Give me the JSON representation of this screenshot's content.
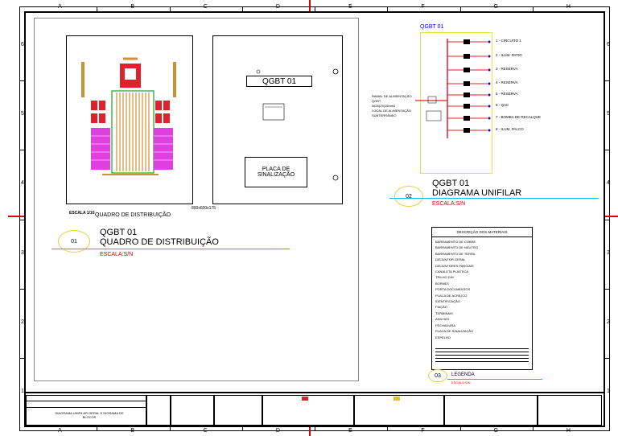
{
  "columns": [
    "A",
    "B",
    "C",
    "D",
    "E",
    "F",
    "G",
    "H"
  ],
  "rows": [
    "6",
    "5",
    "4",
    "3",
    "2",
    "1"
  ],
  "view1": {
    "number": "01",
    "title_line1": "QGBT 01",
    "title_line2": "QUADRO DE DISTRIBUIÇÃO",
    "scale": "ESCALA:S/N",
    "caption": "QUADRO DE DISTRIBUIÇÃO",
    "caption_scale": "ESCALA 1/10",
    "dim_label": "800x600x175"
  },
  "door": {
    "tag": "QGBT 01",
    "plate": "PLACA DE SINALIZAÇÃO"
  },
  "view2": {
    "number": "02",
    "title_line1": "QGBT 01",
    "title_line2": "DIAGRAMA UNIFILAR",
    "scale": "ESCALA:S/N",
    "header": "QGBT 01",
    "feeder_note": [
      "RAMAL DE ALIMENTAÇÃO",
      "QGBT",
      "3#25(25)16mm2",
      "LOCAL DE ALIMENTAÇÃO",
      "SUBTERRÂNEO"
    ],
    "circuits": [
      "1 - CIRCUITO 1",
      "2 - ILUM. PATIO",
      "3 - RESERVA",
      "4 - RESERVA",
      "5 - RESERVA",
      "6 - QAC",
      "7 - BOMBA DE RECALQUE",
      "8 - ILUM. PALCO"
    ]
  },
  "materials": {
    "title": "DESCRIÇÃO DOS MATERIAIS",
    "items": [
      "BARRAMENTO DE COBRE",
      "BARRAMENTO DE NEUTRO",
      "BARRAMENTO DE TERRA",
      "DISJUNTOR GERAL",
      "DISJUNTORES PARCIAIS",
      "CANALETA PLÁSTICA",
      "TRILHO DIN",
      "BORNES",
      "PORTA DOCUMENTOS",
      "PLACA DE ACRÍLICO",
      "IDENTIFICAÇÃO",
      "FIAÇÃO",
      "TERMINAIS",
      "ANILHAS",
      "FECHADURA",
      "PLACA DE SINALIZAÇÃO",
      "ESPELHO"
    ]
  },
  "legend": {
    "number": "03",
    "title": "LEGENDA",
    "scale": "ESCALA:S/N"
  },
  "titleblock": {
    "drawing_title": "DIAGRAMA UNIFILAR GERAL E DIGRAMA DE BLOCOS"
  },
  "colors": {
    "panel_red": "#e0202a",
    "panel_magenta": "#e040e0",
    "panel_orange": "#d09030",
    "panel_green": "#20a020",
    "unifilar_blue": "#0000ee",
    "unifilar_yellow": "#e8e040",
    "accent_red": "#d00000",
    "cyan_line": "#00c0e0"
  }
}
